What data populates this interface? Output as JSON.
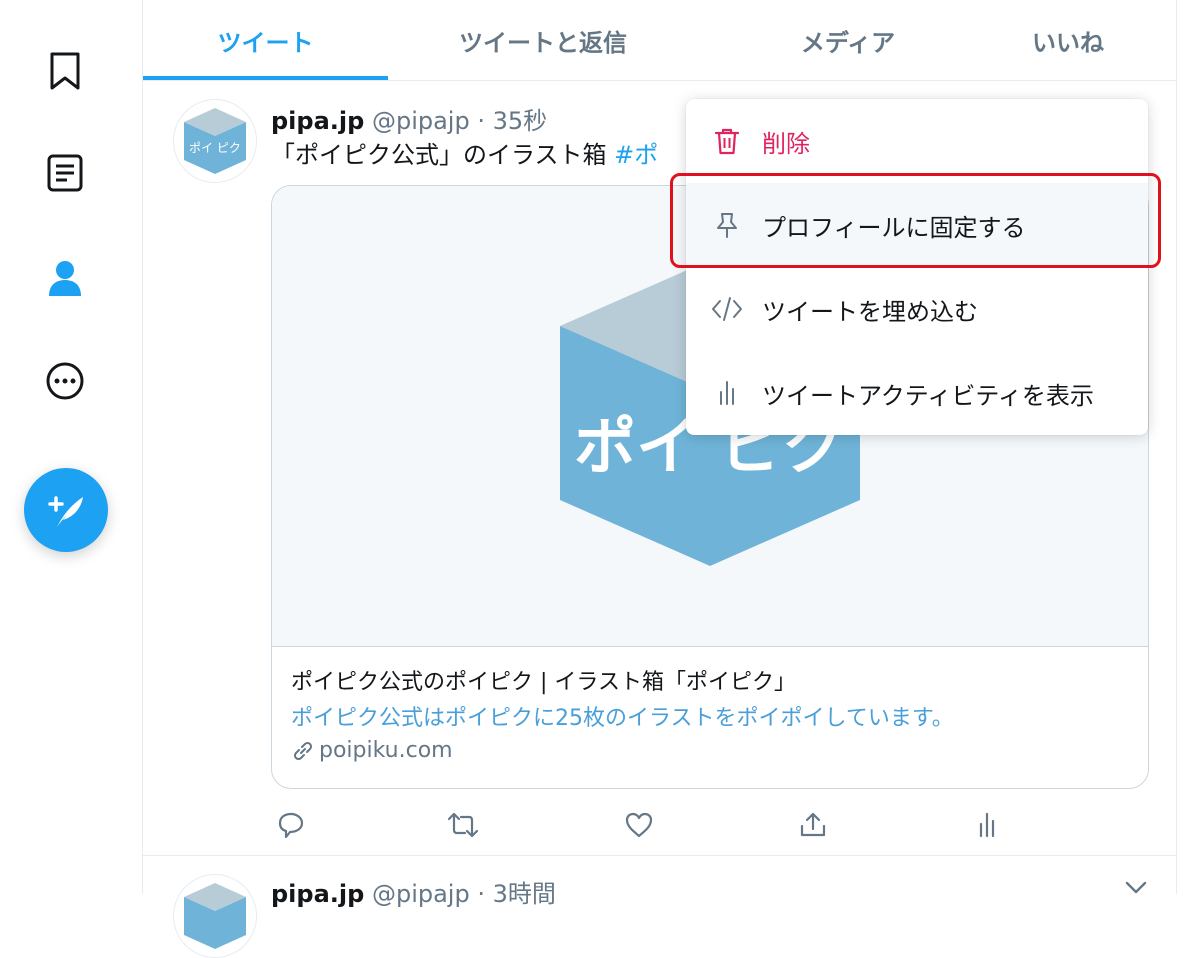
{
  "tabs": [
    {
      "label": "ツイート"
    },
    {
      "label": "ツイートと返信"
    },
    {
      "label": "メディア"
    },
    {
      "label": "いいね"
    }
  ],
  "tweet": {
    "name": "pipa.jp",
    "handle": "@pipajp",
    "separator": "·",
    "time": "35秒",
    "text": "「ポイピク公式」のイラスト箱 ",
    "hashtag": "#ポ",
    "avatar_text": "ポイ ピク",
    "card": {
      "image_text": "ポイ ピク",
      "title": "ポイピク公式のポイピク | イラスト箱「ポイピク」",
      "description": "ポイピク公式はポイピクに25枚のイラストをポイポイしています。",
      "domain": "poipiku.com"
    }
  },
  "tweet2": {
    "name": "pipa.jp",
    "handle": "@pipajp",
    "separator": "·",
    "time": "3時間"
  },
  "menu": {
    "items": [
      {
        "label": "削除",
        "icon": "trash-icon"
      },
      {
        "label": "プロフィールに固定する",
        "icon": "pin-icon"
      },
      {
        "label": "ツイートを埋め込む",
        "icon": "code-icon"
      },
      {
        "label": "ツイートアクティビティを表示",
        "icon": "stats-icon"
      }
    ]
  },
  "colors": {
    "accent": "#1da1f2",
    "danger": "#e0245e",
    "highlight": "#e0101c",
    "box_front": "#6fb4d8",
    "box_top": "#b8ccd8"
  }
}
